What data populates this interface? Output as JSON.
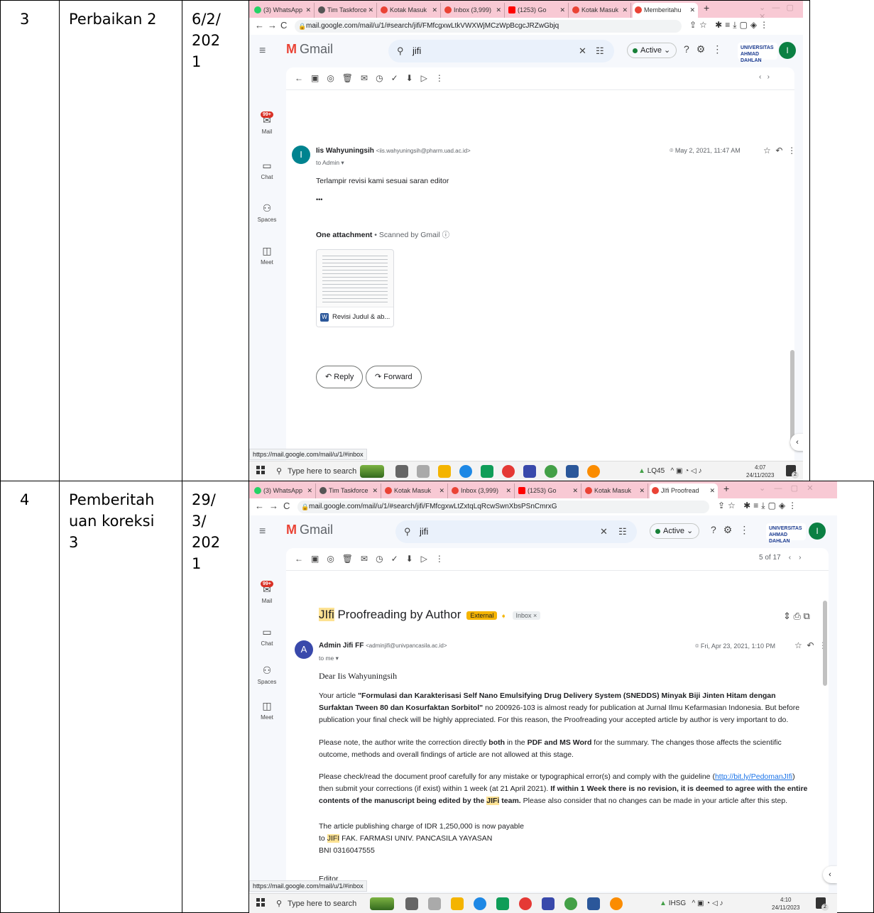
{
  "rows": [
    {
      "no": "3",
      "title_lines": [
        "Perbaikan 2"
      ],
      "date_lines": [
        "6/2/",
        "202",
        "1"
      ],
      "browser": {
        "tabs": [
          "(3) WhatsApp",
          "Tim Taskforce",
          "Kotak Masuk",
          "Inbox (3,999)",
          "(1253) Go",
          "Kotak Masuk",
          "Memberitahu"
        ],
        "url": "mail.google.com/mail/u/1/#search/jifi/FMfcgxwLtkVWXWjMCzWpBcgcJRZwGbjq"
      },
      "gmail": {
        "logo": "Gmail",
        "search_query": "jifi",
        "status": "Active",
        "org": "UNIVERSITAS AHMAD DAHLAN",
        "avatar_letter": "I",
        "rail": [
          {
            "label": "Mail",
            "badge": "99+"
          },
          {
            "label": "Chat"
          },
          {
            "label": "Spaces"
          },
          {
            "label": "Meet"
          }
        ],
        "sender_name": "Iis Wahyuningsih",
        "sender_email": "<iis.wahyuningsih@pharm.uad.ac.id>",
        "sender_initial": "I",
        "to": "to Admin ▾",
        "date": "May 2, 2021, 11:47 AM",
        "body": "Terlampir revisi kami sesuai saran editor",
        "ellipsis": "•••",
        "attach_heading": "One attachment",
        "attach_scanned": "• Scanned by Gmail ⓘ",
        "attach_name": "Revisi Judul & ab...",
        "reply": "Reply",
        "forward": "Forward",
        "status_url": "https://mail.google.com/mail/u/1/#inbox"
      },
      "taskbar": {
        "search_placeholder": "Type here to search",
        "stock": "LQ45",
        "time": "4:07",
        "date": "24/11/2023",
        "notifications": "2"
      }
    },
    {
      "no": "4",
      "title_lines": [
        "Pemberitah",
        "uan koreksi",
        "3"
      ],
      "date_lines": [
        "29/",
        "3/",
        "202",
        "1"
      ],
      "browser": {
        "tabs": [
          "(3) WhatsApp",
          "Tim Taskforce",
          "Kotak Masuk",
          "Inbox (3,999)",
          "(1253) Go",
          "Kotak Masuk",
          "JIfi Proofread"
        ],
        "url": "mail.google.com/mail/u/1/#search/jifi/FMfcgxwLtZxtqLqRcwSwnXbsPSnCmrxG"
      },
      "gmail": {
        "logo": "Gmail",
        "search_query": "jifi",
        "status": "Active",
        "org": "UNIVERSITAS AHMAD DAHLAN",
        "avatar_letter": "I",
        "rail": [
          {
            "label": "Mail",
            "badge": "99+"
          },
          {
            "label": "Chat"
          },
          {
            "label": "Spaces"
          },
          {
            "label": "Meet"
          }
        ],
        "pager": "5 of 17",
        "subject_hl": "JIfi",
        "subject": " Proofreading by Author",
        "label_external": "External",
        "label_inbox": "Inbox ×",
        "sender_name": "Admin Jifi FF",
        "sender_email": "<adminjifi@univpancasila.ac.id>",
        "sender_initial": "A",
        "to": "to me ▾",
        "date": "Fri, Apr 23, 2021, 1:10 PM",
        "greeting": "Dear  Iis Wahyuningsih",
        "p1_a": "Your article ",
        "p1_b": "\"Formulasi dan Karakterisasi  Self Nano Emulsifying Drug Delivery System (SNEDDS) Minyak Biji Jinten Hitam dengan Surfaktan Tween 80 dan Kosurfaktan Sorbitol\"",
        "p1_c": " no 200926-103 is almost ready for publication at Jurnal Ilmu Kefarmasian Indonesia. But before publication your final check will be highly appreciated. For this reason, the Proofreading your accepted article by author is very important to do.",
        "p2_a": "Please note, the author write the correction directly ",
        "p2_b": "both",
        "p2_c": " in the ",
        "p2_d": "PDF and MS Word",
        "p2_e": " for the summary. The changes those affects the scientific outcome, methods and overall findings of article are not allowed at this stage.",
        "p3_a": "Please check/read the document proof carefully for any mistake or typographical error(s) and comply with the guideline (",
        "p3_link": "http://bit.ly/PedomanJIfi",
        "p3_b": ") then submit your corrections (if exist) within 1 week (at 21 April 2021). ",
        "p3_c": "If within 1 Week there is no revision, it is deemed to agree with the entire contents of the manuscript being edited by the ",
        "p3_hl": "JIFi",
        "p3_d": " team.",
        "p3_e": " Please also consider that no changes can be made in your article after this step.",
        "p4_1": "The article publishing charge of IDR 1,250,000 is now payable",
        "p4_2a": "to ",
        "p4_2hl": "JIFI",
        "p4_2b": " FAK. FARMASI UNIV. PANCASILA YAYASAN",
        "p4_3": "BNI 0316047555",
        "p5": "Editor",
        "status_url": "https://mail.google.com/mail/u/1/#inbox"
      },
      "taskbar": {
        "search_placeholder": "Type here to search",
        "stock": "IHSG",
        "time": "4:10",
        "date": "24/11/2023",
        "notifications": "2"
      }
    }
  ],
  "colors": {
    "tabbar": "#f8c9d4",
    "gmail_red": "#ea4335",
    "active_green": "#188038",
    "highlight": "#fde293",
    "external_label": "#f5b400"
  }
}
